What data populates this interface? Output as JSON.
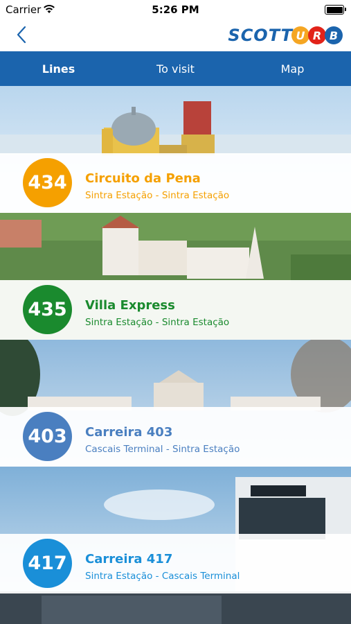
{
  "status_bar": {
    "carrier": "Carrier",
    "time": "5:26 PM"
  },
  "header": {
    "logo_word": "SCOTT",
    "logo_letters": [
      {
        "char": "U",
        "color": "#f5a623"
      },
      {
        "char": "R",
        "color": "#e2231a"
      },
      {
        "char": "B",
        "color": "#1b64ad"
      }
    ]
  },
  "tabs": [
    {
      "label": "Lines",
      "active": true
    },
    {
      "label": "To visit",
      "active": false
    },
    {
      "label": "Map",
      "active": false
    }
  ],
  "lines": [
    {
      "number": "434",
      "name": "Circuito da Pena",
      "route": "Sintra Estação - Sintra Estação",
      "color": "#f5a000"
    },
    {
      "number": "435",
      "name": "Villa Express",
      "route": "Sintra Estação - Sintra Estação",
      "color": "#1a8a2e"
    },
    {
      "number": "403",
      "name": "Carreira 403",
      "route": "Cascais Terminal - Sintra Estação",
      "color": "#4a7fc0"
    },
    {
      "number": "417",
      "name": "Carreira 417",
      "route": "Sintra Estação - Cascais Terminal",
      "color": "#1a8fd8"
    }
  ]
}
